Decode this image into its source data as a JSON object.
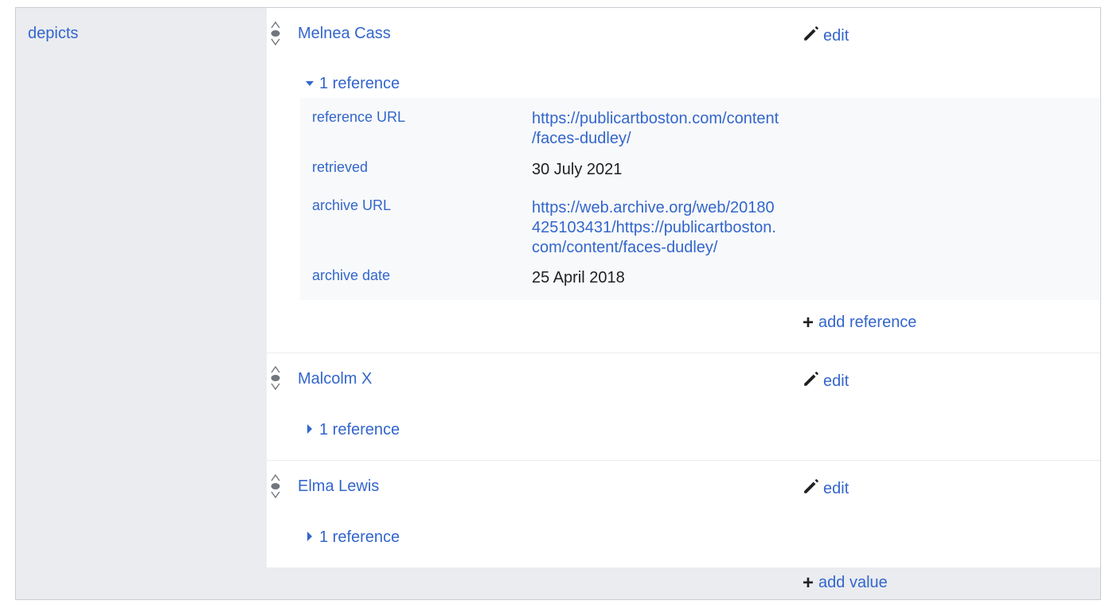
{
  "property": {
    "label": "depicts"
  },
  "statements": [
    {
      "value": "Melnea Cass",
      "edit_label": "edit",
      "refs_toggle": "1 reference",
      "refs_expanded": true,
      "references": [
        {
          "prop": "reference URL",
          "value": "https://publicartboston.com/content\n/faces-dudley/"
        },
        {
          "prop": "retrieved",
          "value": "30 July 2021"
        },
        {
          "prop": "archive URL",
          "value": "https://web.archive.org/web/20180\n425103431/https://publicartboston.\ncom/content/faces-dudley/"
        },
        {
          "prop": "archive date",
          "value": "25 April 2018"
        }
      ],
      "add_reference_label": "add reference"
    },
    {
      "value": "Malcolm X",
      "edit_label": "edit",
      "refs_toggle": "1 reference",
      "refs_expanded": false
    },
    {
      "value": "Elma Lewis",
      "edit_label": "edit",
      "refs_toggle": "1 reference",
      "refs_expanded": false
    }
  ],
  "add_value_label": "add value",
  "colors": {
    "link": "#3366cc",
    "panel": "#eaecf0",
    "ref_bg": "#f8f9fa",
    "border": "#c8ccd1"
  },
  "icons": {
    "edit": "pencil-icon",
    "rank": "normal-rank-icon",
    "expanded": "triangle-down-icon",
    "collapsed": "triangle-right-icon",
    "add": "plus-icon"
  }
}
